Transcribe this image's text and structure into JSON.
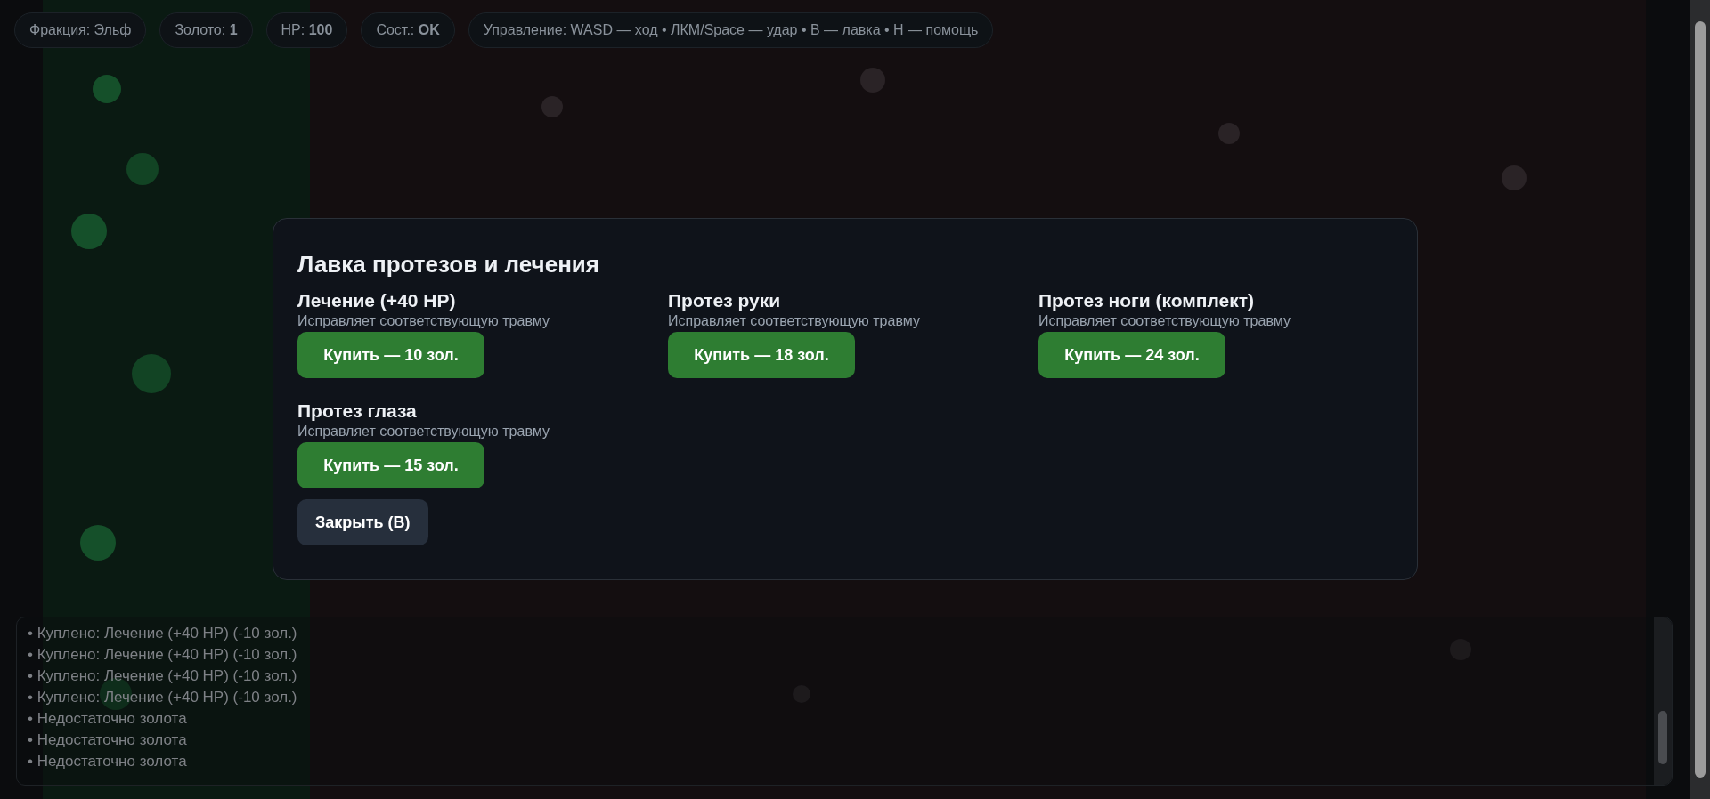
{
  "hud": [
    "Фракция: Эльф",
    "Золото: **1**",
    "HP: **100**",
    "Сост.: **OK**",
    "Управление: WASD — ход • ЛКМ/Space — удар • B — лавка • H — помощь"
  ],
  "shop": {
    "title": "Лавка протезов и лечения",
    "items": [
      {
        "name": "Лечение (+40 HP)",
        "description": "Исправляет соответствующую травму",
        "button": "Купить — 10 зол."
      },
      {
        "name": "Протез руки",
        "description": "Исправляет соответствующую травму",
        "button": "Купить — 18 зол."
      },
      {
        "name": "Протез ноги (комплект)",
        "description": "Исправляет соответствующую травму",
        "button": "Купить — 24 зол."
      },
      {
        "name": "Протез глаза",
        "description": "Исправляет соответствующую травму",
        "button": "Купить — 15 зол."
      }
    ],
    "close_button": "Закрыть (B)"
  },
  "log": [
    "• Куплено: Лечение (+40 HP) (-10 зол.)",
    "• Куплено: Лечение (+40 HP) (-10 зол.)",
    "• Куплено: Лечение (+40 HP) (-10 зол.)",
    "• Куплено: Лечение (+40 HP) (-10 зол.)",
    "• Недостаточно золота",
    "• Недостаточно золота",
    "• Недостаточно золота"
  ]
}
